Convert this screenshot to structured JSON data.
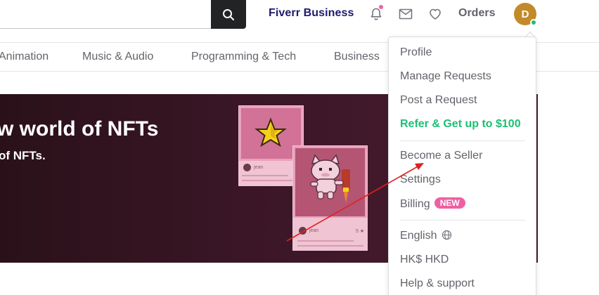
{
  "header": {
    "search": {
      "value": "",
      "placeholder": ""
    },
    "fiverr_business": "Fiverr Business",
    "orders": "Orders",
    "avatar_initial": "D",
    "icons": [
      "search-icon",
      "bell-icon",
      "mail-icon",
      "heart-icon"
    ],
    "colors": {
      "brand_dark": "#1d1a6c",
      "notification_dot": "#f25fa0",
      "online": "#1dbf73",
      "avatar_bg": "#c28a28"
    }
  },
  "categories": [
    "Animation",
    "Music & Audio",
    "Programming & Tech",
    "Business"
  ],
  "hero": {
    "title": "w world of NFTs",
    "subtitle": "of NFTs.",
    "cards": [
      {
        "name": "jean"
      },
      {
        "name": "jean",
        "rating": "5 ★"
      }
    ]
  },
  "dropdown": {
    "items": [
      {
        "label": "Profile"
      },
      {
        "label": "Manage Requests"
      },
      {
        "label": "Post a Request"
      },
      {
        "label": "Refer & Get up to $100",
        "accent": "#1dbf73"
      },
      {
        "label": "Become a Seller"
      },
      {
        "label": "Settings"
      },
      {
        "label": "Billing",
        "badge": "NEW"
      },
      {
        "label": "English"
      },
      {
        "label": "HK$ HKD"
      },
      {
        "label": "Help & support"
      }
    ]
  }
}
